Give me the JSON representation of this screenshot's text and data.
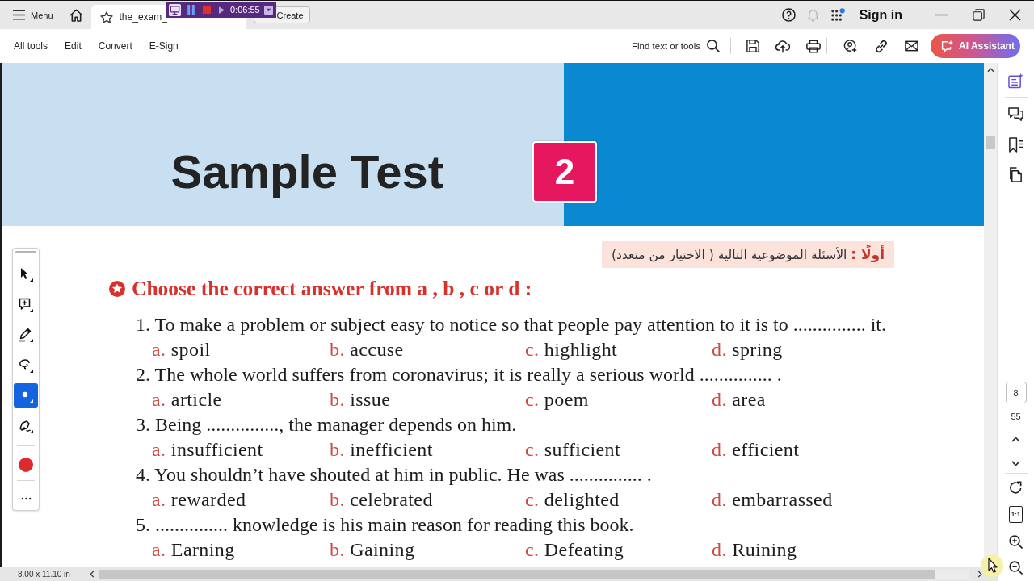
{
  "title_bar": {
    "menu": "Menu",
    "tab": "the_exam_",
    "create": "Create",
    "sign_in": "Sign in"
  },
  "recorder": {
    "time": "0:06:55"
  },
  "toolbar": {
    "menus": [
      "All tools",
      "Edit",
      "Convert",
      "E-Sign"
    ],
    "search": "Find text or tools",
    "ai_assistant": "AI Assistant"
  },
  "annotation_tools": [
    {
      "kind": "select",
      "selected": false
    },
    {
      "kind": "comment",
      "selected": false
    },
    {
      "kind": "highlight",
      "selected": false
    },
    {
      "kind": "freehand",
      "selected": false
    },
    {
      "kind": "dot",
      "selected": true
    },
    {
      "kind": "sign",
      "selected": false
    }
  ],
  "document": {
    "banner": {
      "title": "Sample Test",
      "number": "2"
    },
    "section_heading": {
      "lead": "أولًا :",
      "text": "الأسئلة الموضوعية التالية ( الاختيار من متعدد)"
    },
    "instruction": "Choose the correct answer from a , b , c or d :",
    "questions": [
      {
        "text": "1. To make a problem or subject easy to notice so that people pay attention to it is to ............... it.",
        "options": [
          {
            "letter": "a.",
            "text": "spoil"
          },
          {
            "letter": "b.",
            "text": "accuse"
          },
          {
            "letter": "c.",
            "text": "highlight"
          },
          {
            "letter": "d.",
            "text": "spring"
          }
        ]
      },
      {
        "text": "2. The whole world suffers from coronavirus; it is really a serious world ............... .",
        "options": [
          {
            "letter": "a.",
            "text": "article"
          },
          {
            "letter": "b.",
            "text": "issue"
          },
          {
            "letter": "c.",
            "text": "poem"
          },
          {
            "letter": "d.",
            "text": "area"
          }
        ]
      },
      {
        "text": "3. Being ..............., the manager depends on him.",
        "options": [
          {
            "letter": "a.",
            "text": "insufficient"
          },
          {
            "letter": "b.",
            "text": "inefficient"
          },
          {
            "letter": "c.",
            "text": "sufficient"
          },
          {
            "letter": "d.",
            "text": "efficient"
          }
        ]
      },
      {
        "text": "4. You shouldn’t have shouted at him in public. He was ............... .",
        "options": [
          {
            "letter": "a.",
            "text": "rewarded"
          },
          {
            "letter": "b.",
            "text": "celebrated"
          },
          {
            "letter": "c.",
            "text": "delighted"
          },
          {
            "letter": "d.",
            "text": "embarrassed"
          }
        ]
      },
      {
        "text": "5. ............... knowledge is his main reason for reading this book.",
        "options": [
          {
            "letter": "a.",
            "text": "Earning"
          },
          {
            "letter": "b.",
            "text": "Gaining"
          },
          {
            "letter": "c.",
            "text": "Defeating"
          },
          {
            "letter": "d.",
            "text": "Ruining"
          }
        ]
      }
    ]
  },
  "page_nav": {
    "page": "8",
    "total": "55",
    "fit": "1:1"
  },
  "status_bar": {
    "page_size": "8.00 x 11.10 in"
  }
}
